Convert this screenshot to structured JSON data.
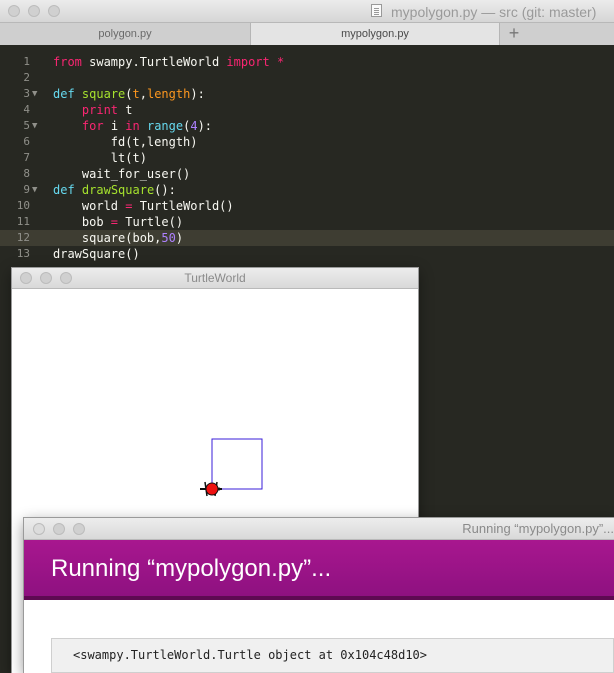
{
  "editor": {
    "window_title": "mypolygon.py — src (git: master)",
    "tabs": [
      {
        "label": "polygon.py"
      },
      {
        "label": "mypolygon.py"
      }
    ],
    "new_tab_label": "+",
    "lines": [
      {
        "n": "1",
        "fold": false,
        "tokens": [
          [
            "kw",
            "from"
          ],
          [
            "pl",
            " swampy.TurtleWorld "
          ],
          [
            "kw",
            "import"
          ],
          [
            "pl",
            " "
          ],
          [
            "kw",
            "*"
          ]
        ]
      },
      {
        "n": "2",
        "fold": false,
        "tokens": []
      },
      {
        "n": "3",
        "fold": true,
        "tokens": [
          [
            "bi",
            "def"
          ],
          [
            "pl",
            " "
          ],
          [
            "fn",
            "square"
          ],
          [
            "pl",
            "("
          ],
          [
            "ar",
            "t"
          ],
          [
            "pl",
            ","
          ],
          [
            "ar",
            "length"
          ],
          [
            "pl",
            "):"
          ]
        ]
      },
      {
        "n": "4",
        "fold": false,
        "tokens": [
          [
            "pl",
            "    "
          ],
          [
            "kw",
            "print"
          ],
          [
            "pl",
            " t"
          ]
        ]
      },
      {
        "n": "5",
        "fold": true,
        "tokens": [
          [
            "pl",
            "    "
          ],
          [
            "kw",
            "for"
          ],
          [
            "pl",
            " i "
          ],
          [
            "kw",
            "in"
          ],
          [
            "pl",
            " "
          ],
          [
            "bi",
            "range"
          ],
          [
            "pl",
            "("
          ],
          [
            "nm",
            "4"
          ],
          [
            "pl",
            "):"
          ]
        ]
      },
      {
        "n": "6",
        "fold": false,
        "tokens": [
          [
            "pl",
            "        fd(t,length)"
          ]
        ]
      },
      {
        "n": "7",
        "fold": false,
        "tokens": [
          [
            "pl",
            "        lt(t)"
          ]
        ]
      },
      {
        "n": "8",
        "fold": false,
        "tokens": [
          [
            "pl",
            "    wait_for_user()"
          ]
        ]
      },
      {
        "n": "9",
        "fold": true,
        "tokens": [
          [
            "bi",
            "def"
          ],
          [
            "pl",
            " "
          ],
          [
            "fn",
            "drawSquare"
          ],
          [
            "pl",
            "():"
          ]
        ]
      },
      {
        "n": "10",
        "fold": false,
        "tokens": [
          [
            "pl",
            "    world "
          ],
          [
            "kw",
            "="
          ],
          [
            "pl",
            " TurtleWorld()"
          ]
        ]
      },
      {
        "n": "11",
        "fold": false,
        "tokens": [
          [
            "pl",
            "    bob "
          ],
          [
            "kw",
            "="
          ],
          [
            "pl",
            " Turtle()"
          ]
        ]
      },
      {
        "n": "12",
        "fold": false,
        "current": true,
        "tokens": [
          [
            "pl",
            "    square(bob,"
          ],
          [
            "nm",
            "50"
          ],
          [
            "pl",
            ")"
          ]
        ]
      },
      {
        "n": "13",
        "fold": false,
        "tokens": [
          [
            "pl",
            "drawSquare()"
          ]
        ]
      }
    ]
  },
  "turtle_world": {
    "window_title": "TurtleWorld",
    "square_color": "#3a1ed8",
    "turtle_color": "#ee1111"
  },
  "running": {
    "window_title": "Running “mypolygon.py”...",
    "heading": "Running “mypolygon.py”...",
    "output": "<swampy.TurtleWorld.Turtle object at 0x104c48d10>",
    "header_color": "#8e1180"
  }
}
